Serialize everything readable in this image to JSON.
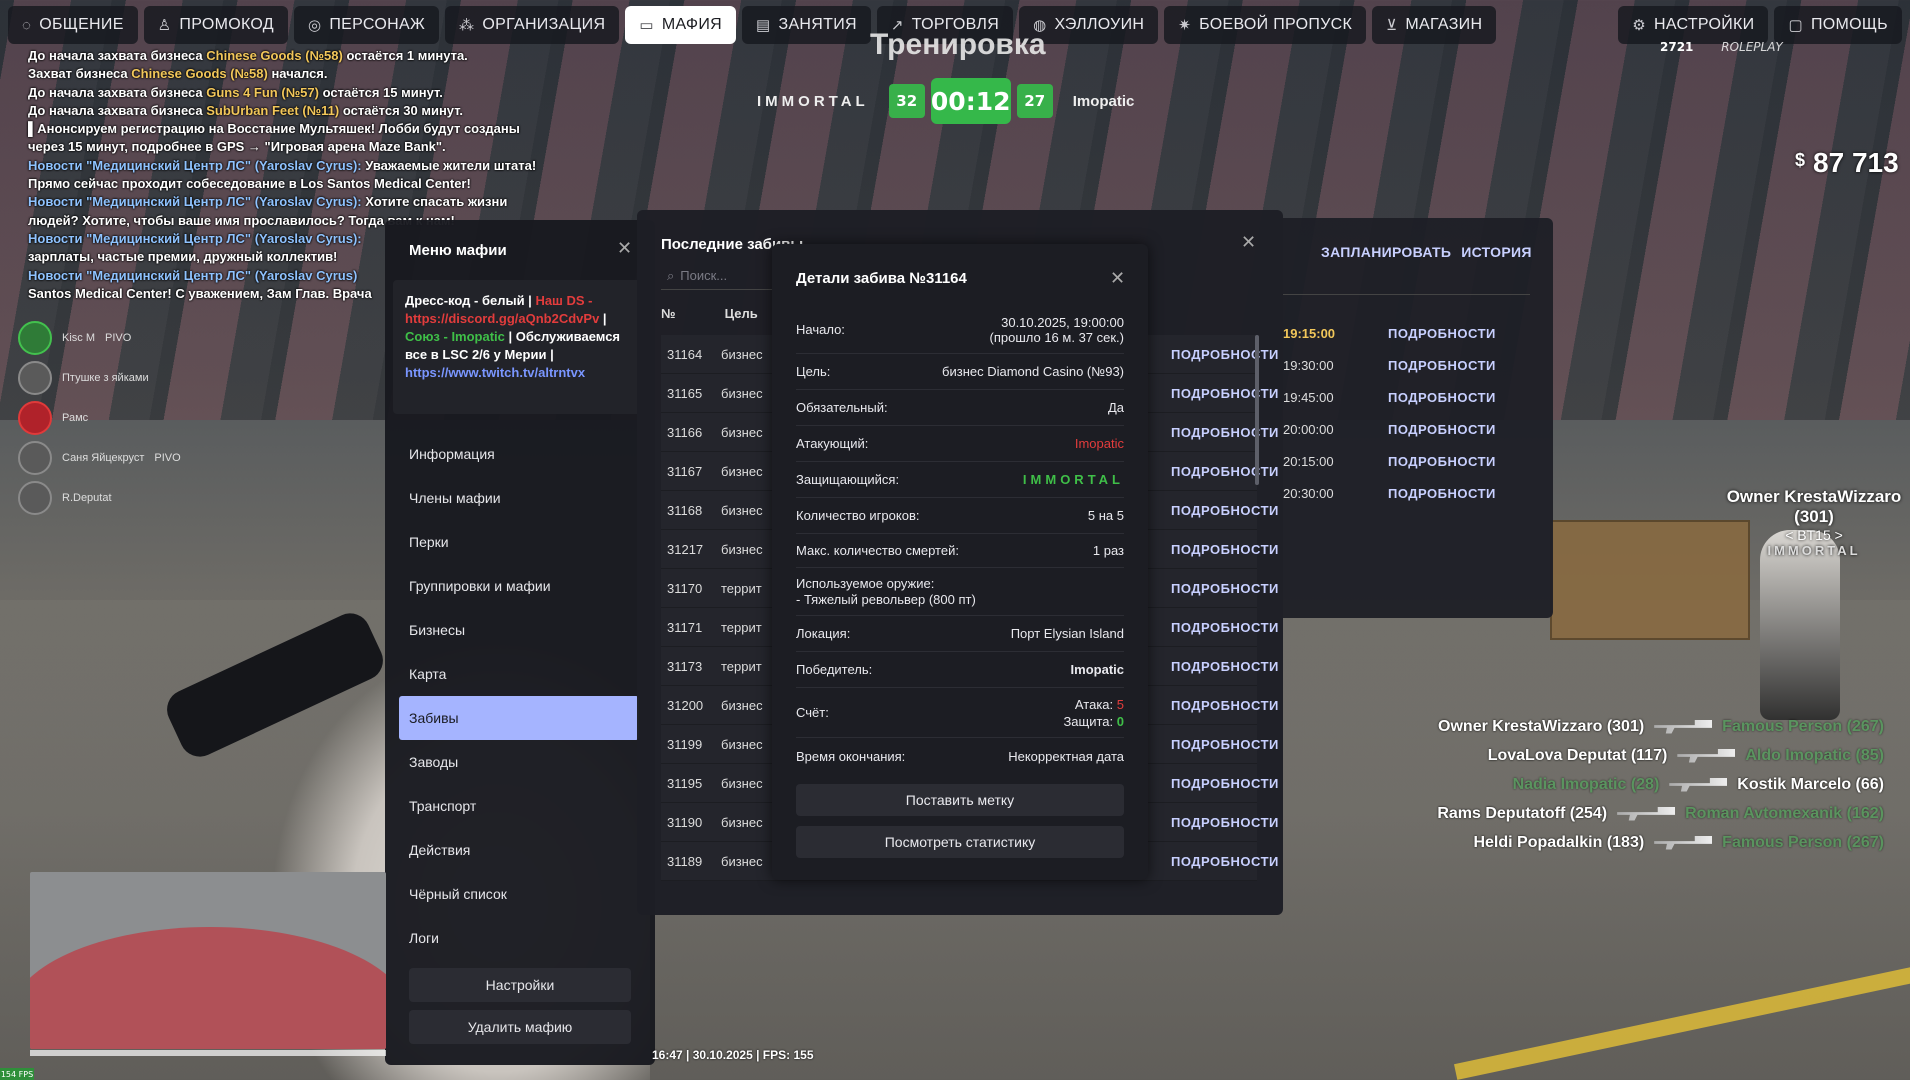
{
  "nav": {
    "left": [
      {
        "icon": "chat-icon",
        "glyph": "◌",
        "label": "ОБЩЕНИЕ"
      },
      {
        "icon": "person-icon",
        "glyph": "♙",
        "label": "ПРОМОКОД"
      },
      {
        "icon": "user-icon",
        "glyph": "◎",
        "label": "ПЕРСОНАЖ"
      },
      {
        "icon": "org-icon",
        "glyph": "⁂",
        "label": "ОРГАНИЗАЦИЯ"
      },
      {
        "icon": "mask-icon",
        "glyph": "▭",
        "label": "МАФИЯ",
        "active": true
      },
      {
        "icon": "book-icon",
        "glyph": "▤",
        "label": "ЗАНЯТИЯ"
      },
      {
        "icon": "chart-icon",
        "glyph": "↗",
        "label": "ТОРГОВЛЯ"
      },
      {
        "icon": "pumpkin-icon",
        "glyph": "◍",
        "label": "ХЭЛЛОУИН"
      },
      {
        "icon": "gear-badge-icon",
        "glyph": "✷",
        "label": "БОЕВОЙ ПРОПУСК"
      },
      {
        "icon": "cart-icon",
        "glyph": "⊻",
        "label": "МАГАЗИН"
      }
    ],
    "right": [
      {
        "icon": "settings-icon",
        "glyph": "⚙",
        "label": "НАСТРОЙКИ"
      },
      {
        "icon": "help-icon",
        "glyph": "▢",
        "label": "ПОМОЩЬ"
      }
    ]
  },
  "chat": [
    {
      "parts": [
        {
          "t": "До начала захвата бизнеса ",
          "c": "in"
        },
        {
          "t": "Chinese Goods (№58)",
          "c": "hl"
        },
        {
          "t": " остаётся 1 минута.",
          "c": "in"
        }
      ]
    },
    {
      "parts": [
        {
          "t": "Захват бизнеса ",
          "c": "in"
        },
        {
          "t": "Chinese Goods (№58)",
          "c": "hl"
        },
        {
          "t": " начался.",
          "c": "in"
        }
      ]
    },
    {
      "parts": [
        {
          "t": "До начала захвата бизнеса ",
          "c": "in"
        },
        {
          "t": "Guns 4 Fun (№57)",
          "c": "hl"
        },
        {
          "t": " остаётся 15 минут.",
          "c": "in"
        }
      ]
    },
    {
      "parts": [
        {
          "t": "До начала захвата бизнеса ",
          "c": "in"
        },
        {
          "t": "SubUrban Feet (№11)",
          "c": "hl"
        },
        {
          "t": " остаётся 30 минут.",
          "c": "in"
        }
      ]
    },
    {
      "parts": [
        {
          "t": "▌Анонсируем регистрацию на Восстание Мультяшек! Лобби будут созданы",
          "c": "in"
        }
      ]
    },
    {
      "parts": [
        {
          "t": "через 15 минут, подробнее в GPS → \"Игровая арена Maze Bank\".",
          "c": "in"
        }
      ]
    },
    {
      "parts": [
        {
          "t": "Новости \"Медицинский Центр ЛС\" (Yaroslav Cyrus):",
          "c": "nw"
        },
        {
          "t": " Уважаемые жители штата!",
          "c": "in"
        }
      ]
    },
    {
      "parts": [
        {
          "t": "Прямо сейчас проходит собеседование в Los Santos Medical Center!",
          "c": "in"
        }
      ]
    },
    {
      "parts": [
        {
          "t": "Новости \"Медицинский Центр ЛС\" (Yaroslav Cyrus):",
          "c": "nw"
        },
        {
          "t": " Хотите спасать жизни",
          "c": "in"
        }
      ]
    },
    {
      "parts": [
        {
          "t": "людей? Хотите, чтобы ваше имя прославилось? Тогда вам к нам!",
          "c": "in"
        }
      ]
    },
    {
      "parts": [
        {
          "t": "Новости \"Медицинский Центр ЛС\" (Yaroslav Cyrus):",
          "c": "nw"
        }
      ]
    },
    {
      "parts": [
        {
          "t": "зарплаты, частые премии, дружный коллектив!",
          "c": "in"
        }
      ]
    },
    {
      "parts": [
        {
          "t": "Новости \"Медицинский Центр ЛС\" (Yaroslav Cyrus)",
          "c": "nw"
        }
      ]
    },
    {
      "parts": [
        {
          "t": "Santos Medical Center! С уважением, Зам Глав. Врача",
          "c": "in"
        }
      ]
    }
  ],
  "hud": {
    "title": "Тренировка",
    "team_left": "IMMORTAL",
    "score_left": "32",
    "timer": "00:12",
    "score_right": "27",
    "team_right": "Imopatic",
    "money_symbol": "$",
    "money": "87 713",
    "accent_green": "#35b84a"
  },
  "players": [
    {
      "name": "Kisc M",
      "tag": "PIVO",
      "style": "g"
    },
    {
      "name": "Птушке з яйками",
      "tag": "",
      "style": ""
    },
    {
      "name": "Рамс",
      "tag": "",
      "style": "red"
    },
    {
      "name": "Саня Яйцекруст",
      "tag": "PIVO",
      "style": ""
    },
    {
      "name": "R.Deputat",
      "tag": "",
      "style": ""
    }
  ],
  "mafia": {
    "title": "Меню мафии",
    "motd": [
      {
        "t": "Дресс-код - белый | ",
        "c": ""
      },
      {
        "t": "Наш DS - https://discord.gg/aQnb2CdvPv",
        "c": "r"
      },
      {
        "t": " | ",
        "c": ""
      },
      {
        "t": "Союз - Imopatic",
        "c": "g"
      },
      {
        "t": " | Обслуживаемся все в LSC 2/6 у Мерии | ",
        "c": ""
      },
      {
        "t": "https://www.twitch.tv/altrntvx",
        "c": "b"
      }
    ],
    "nav": [
      "Информация",
      "Члены мафии",
      "Перки",
      "Группировки и мафии",
      "Бизнесы",
      "Карта",
      "Забивы",
      "Заводы",
      "Транспорт",
      "Действия",
      "Чёрный список",
      "Логи"
    ],
    "active_index": 6,
    "btn_settings": "Настройки",
    "btn_delete": "Удалить мафию"
  },
  "recent": {
    "title": "Последние забивы",
    "search_placeholder": "Поиск...",
    "col_id": "№",
    "col_target": "Цель",
    "more_label": "ПОДРОБНОСТИ",
    "rows": [
      {
        "id": "31164",
        "target": "бизнес"
      },
      {
        "id": "31165",
        "target": "бизнес"
      },
      {
        "id": "31166",
        "target": "бизнес"
      },
      {
        "id": "31167",
        "target": "бизнес"
      },
      {
        "id": "31168",
        "target": "бизнес"
      },
      {
        "id": "31217",
        "target": "бизнес"
      },
      {
        "id": "31170",
        "target": "террит"
      },
      {
        "id": "31171",
        "target": "террит"
      },
      {
        "id": "31173",
        "target": "террит"
      },
      {
        "id": "31200",
        "target": "бизнес"
      },
      {
        "id": "31199",
        "target": "бизнес"
      },
      {
        "id": "31195",
        "target": "бизнес"
      },
      {
        "id": "31190",
        "target": "бизнес"
      },
      {
        "id": "31189",
        "target": "бизнес"
      }
    ]
  },
  "planned": {
    "tab_plan": "ЗАПЛАНИРОВАТЬ",
    "tab_history": "ИСТОРИЯ",
    "more_label": "ПОДРОБНОСТИ",
    "rows": [
      {
        "time": "19:15:00",
        "highlight": true
      },
      {
        "time": "19:30:00",
        "highlight": false
      },
      {
        "time": "19:45:00",
        "highlight": false
      },
      {
        "time": "20:00:00",
        "highlight": false
      },
      {
        "time": "20:15:00",
        "highlight": false
      },
      {
        "time": "20:30:00",
        "highlight": false
      }
    ]
  },
  "detail": {
    "title": "Детали забива №31164",
    "start_label": "Начало:",
    "start_value": "30.10.2025, 19:00:00",
    "start_ago": "(прошло 16 м. 37 сек.)",
    "target_label": "Цель:",
    "target_value": "бизнес Diamond Casino (№93)",
    "mandatory_label": "Обязательный:",
    "mandatory_value": "Да",
    "attacker_label": "Атакующий:",
    "attacker_value": "Imopatic",
    "defender_label": "Защищающийся:",
    "defender_value": "IMMORTAL",
    "players_label": "Количество игроков:",
    "players_value": "5 на 5",
    "deaths_label": "Макс. количество смертей:",
    "deaths_value": "1 раз",
    "weapon_label": "Используемое оружие:",
    "weapon_value": "- Тяжелый револьвер (800 пт)",
    "location_label": "Локация:",
    "location_value": "Порт Elysian Island",
    "winner_label": "Победитель:",
    "winner_value": "Imopatic",
    "score_label": "Счёт:",
    "attack_label": "Атака:",
    "attack_value": "5",
    "defense_label": "Защита:",
    "defense_value": "0",
    "end_label": "Время окончания:",
    "end_value": "Некорректная дата",
    "btn_mark": "Поставить метку",
    "btn_stats": "Посмотреть статистику"
  },
  "killfeed": [
    {
      "killer": "Owner KrestaWizzaro (301)",
      "victim": "Famous Person (267)"
    },
    {
      "killer": "LovaLova Deputat (117)",
      "victim": "Aldo Imopatic (85)"
    },
    {
      "killer": "Nadia Imopatic (28)",
      "victim": "Kostik Marcelo (66)",
      "swap": true
    },
    {
      "killer": "Rams Deputatoff (254)",
      "victim": "Roman Avtomexanik (162)"
    },
    {
      "killer": "Heldi Popadalkin (183)",
      "victim": "Famous Person (267)"
    }
  ],
  "player_tag": {
    "name": "Owner KrestaWizzaro (301)",
    "sub": "< BT15 >",
    "org": "IMMORTAL"
  },
  "bottom": {
    "info": "16:47 | 30.10.2025 | FPS: 155",
    "mini_fps": "154 FPS"
  },
  "topright": {
    "roleplay": "ROLEPLAY",
    "count": "2721"
  }
}
